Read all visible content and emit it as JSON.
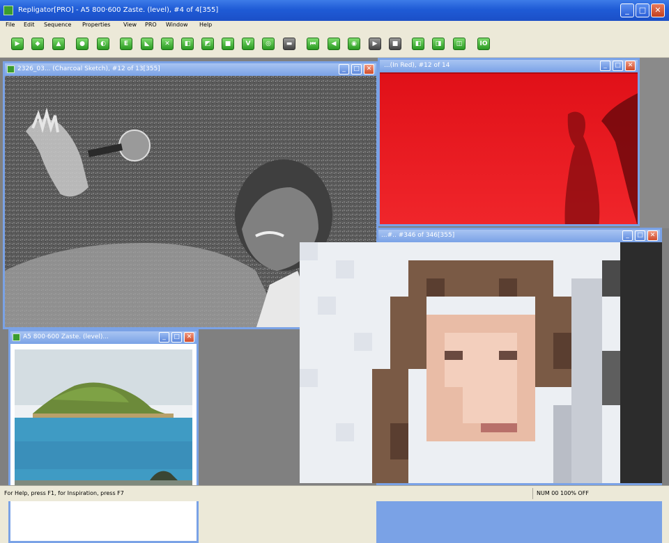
{
  "app": {
    "title": "Repligator[PRO] - A5 800·600 Zaste. (level), #4 of 4[355]"
  },
  "menu": [
    "File",
    "Edit",
    "Sequence",
    "Properties",
    "View",
    "PRO",
    "Window",
    "Help"
  ],
  "toolbar": {
    "buttons": [
      {
        "glyph": "▶"
      },
      {
        "glyph": "◆"
      },
      {
        "glyph": "▲"
      },
      {
        "glyph": "●"
      },
      {
        "glyph": "◐"
      },
      {
        "glyph": "E"
      },
      {
        "glyph": "◣"
      },
      {
        "glyph": "✕"
      },
      {
        "glyph": "◧"
      },
      {
        "glyph": "◩"
      },
      {
        "glyph": "■"
      },
      {
        "glyph": "V"
      },
      {
        "glyph": "◎"
      },
      {
        "glyph": "▬"
      },
      {
        "glyph": "⏮"
      },
      {
        "glyph": "◀"
      },
      {
        "glyph": "◉"
      },
      {
        "glyph": "▶"
      },
      {
        "glyph": "■"
      },
      {
        "glyph": "◧"
      },
      {
        "glyph": "◨"
      },
      {
        "glyph": "◫"
      },
      {
        "glyph": "IO"
      }
    ]
  },
  "windows": {
    "sketch": {
      "title": "2326_03... (Charcoal Sketch), #12 of 13[355]"
    },
    "red": {
      "title": "...(In Red), #12 of 14"
    },
    "pixel": {
      "title": "...#.. #346 of 346[355]"
    },
    "island": {
      "title": "A5 800·600 Zaste. (level)..."
    }
  },
  "status": {
    "left": "For Help, press F1, for Inspiration, press F7",
    "right": "NUM 00 100% OFF"
  },
  "colors": {
    "titlebar": "#1f5bd6",
    "child_active_border": "#7aa2e6",
    "mdi_background": "#808080",
    "red_window": "#e3161a"
  }
}
